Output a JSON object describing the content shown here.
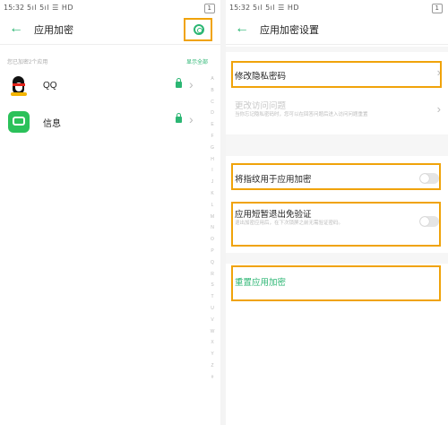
{
  "left": {
    "status": {
      "time": "15:32",
      "signal": "5ıl 5ıl ☰ HD",
      "battery": "1"
    },
    "title": "应用加密",
    "subtitle": "您已加密2个应用",
    "show_all": "显示全部",
    "apps": [
      {
        "name": "QQ"
      },
      {
        "name": "信息"
      }
    ],
    "index_letters": [
      "A",
      "B",
      "C",
      "D",
      "E",
      "F",
      "G",
      "H",
      "I",
      "J",
      "K",
      "L",
      "M",
      "N",
      "O",
      "P",
      "Q",
      "R",
      "S",
      "T",
      "U",
      "V",
      "W",
      "X",
      "Y",
      "Z",
      "#"
    ]
  },
  "right": {
    "status": {
      "time": "15:32",
      "signal": "5ıl 5ıl ☰ HD",
      "battery": "1"
    },
    "title": "应用加密设置",
    "settings": {
      "modify_password": "修改隐私密码",
      "change_question": "更改访问问题",
      "change_question_desc": "当你忘记隐私密码时，您可以在回答问题后进入访问问题重置",
      "fingerprint": "将指纹用于应用加密",
      "short_exit": "应用短暂退出免验证",
      "short_exit_desc": "退出加密应用后，在下次锁屏之前无需验证密码。",
      "reset": "重置应用加密"
    }
  },
  "colors": {
    "accent": "#2bb673",
    "highlight": "#f0a30a"
  }
}
